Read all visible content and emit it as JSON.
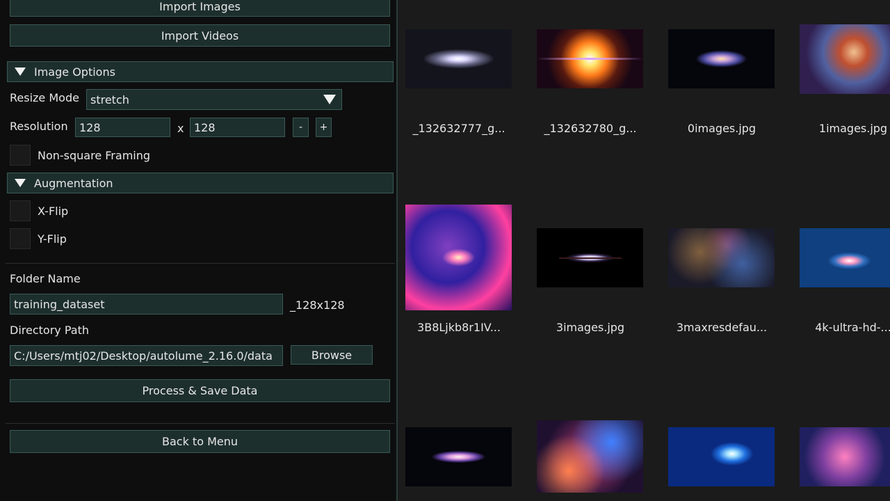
{
  "panel": {
    "import_images": "Import Images",
    "import_videos": "Import Videos",
    "image_options": "Image Options",
    "resize_mode_label": "Resize Mode",
    "resize_mode_value": "stretch",
    "resolution_label": "Resolution",
    "resolution_w": "128",
    "resolution_x": "x",
    "resolution_h": "128",
    "minus": "-",
    "plus": "+",
    "non_square": "Non-square Framing",
    "augmentation": "Augmentation",
    "xflip": "X-Flip",
    "yflip": "Y-Flip",
    "folder_name_label": "Folder Name",
    "folder_name_value": "training_dataset",
    "folder_suffix": "_128x128",
    "directory_label": "Directory Path",
    "directory_value": "C:/Users/mtj02/Desktop/autolume_2.16.0/data",
    "browse": "Browse",
    "process": "Process & Save Data",
    "back": "Back to Menu"
  },
  "gallery": [
    {
      "label": "_132632777_g...",
      "icon": "galaxy-edge-thumbnail"
    },
    {
      "label": "_132632780_g...",
      "icon": "starburst-thumbnail"
    },
    {
      "label": "0images.jpg",
      "icon": "spiral-galaxy-thumbnail"
    },
    {
      "label": "1images.jpg",
      "icon": "nebula-thumbnail"
    },
    {
      "label": "3B8Ljkb8r1IV...",
      "icon": "purple-galaxy-thumbnail"
    },
    {
      "label": "3images.jpg",
      "icon": "sombrero-galaxy-thumbnail"
    },
    {
      "label": "3maxresdefau...",
      "icon": "star-field-thumbnail"
    },
    {
      "label": "4k-ultra-hd-...",
      "icon": "spiral-galaxy-thumbnail"
    },
    {
      "label": "",
      "icon": "barred-galaxy-thumbnail"
    },
    {
      "label": "",
      "icon": "colorful-nebula-thumbnail"
    },
    {
      "label": "",
      "icon": "blue-spiral-galaxy-thumbnail"
    },
    {
      "label": "",
      "icon": "pink-nebula-thumbnail"
    }
  ]
}
